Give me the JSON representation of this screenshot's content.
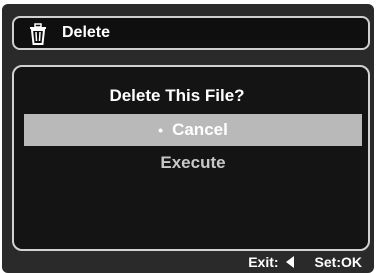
{
  "header": {
    "icon": "trash-icon",
    "title": "Delete"
  },
  "dialog": {
    "question": "Delete This File?",
    "options": [
      {
        "label": "Cancel",
        "selected": true
      },
      {
        "label": "Execute",
        "selected": false
      }
    ],
    "bullet": "•"
  },
  "footer": {
    "exit_label": "Exit:",
    "exit_icon": "left-arrow-icon",
    "set_label": "Set:OK"
  },
  "colors": {
    "screen_bg": "#2a2a2a",
    "selected_row": "#b9b9b9",
    "inactive_text": "#c8c8c8"
  }
}
